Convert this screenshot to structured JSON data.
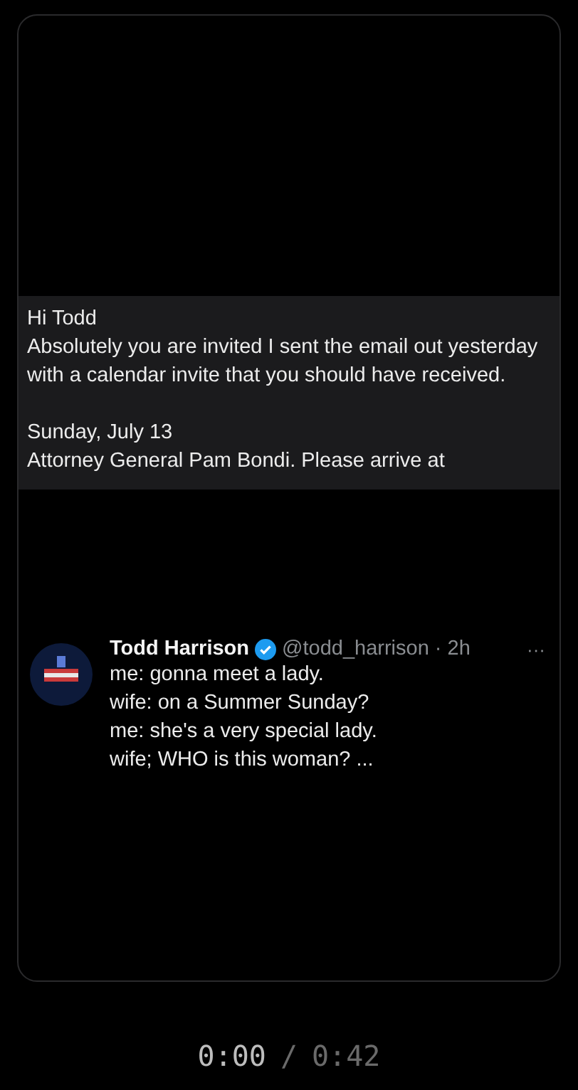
{
  "message": {
    "greeting": "Hi Todd",
    "body": "Absolutely you are invited I sent the email out yesterday with a calendar invite that you should have received.",
    "date": "Sunday, July 13",
    "details": "Attorney General Pam Bondi. Please arrive at"
  },
  "post": {
    "author": "Todd Harrison",
    "verified": true,
    "handle": "@todd_harrison · 2h",
    "more": "···",
    "lines": [
      "me: gonna meet a lady.",
      "wife: on a Summer Sunday?",
      "me: she's a very special lady.",
      "wife; WHO is this woman? ..."
    ]
  },
  "player": {
    "current": "0:00",
    "separator": "/",
    "duration": "0:42"
  }
}
